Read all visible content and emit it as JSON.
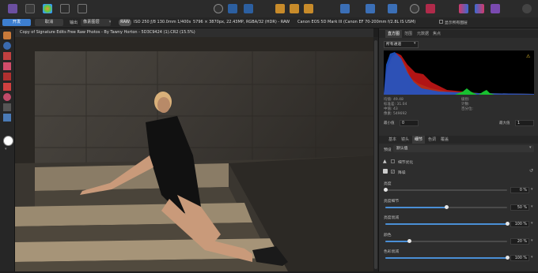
{
  "context_bar": {
    "develop_button": "开发",
    "cancel_button": "取消",
    "output_label": "输出",
    "output_value": "像素图层",
    "raw_badge": "RAW",
    "camera_settings": "ISO 250 ƒ/8 130.0mm 1/400s",
    "image_info": "5796 × 3870px, 22.43MP, RGBA/32 (HDR) - RAW",
    "camera_model": "Canon EOS 5D Mark III (Canon EF 70-200mm f/2.8L IS USM)",
    "show_clipping": "显示所有图层"
  },
  "document": {
    "title": "Copy of Signature Edits Free Raw Photos - By Tawny Horton - 5D3C9424 (1).CR2 (15.5%)"
  },
  "panel": {
    "top_tabs": [
      "直方图",
      "范围",
      "元数据",
      "焦点"
    ],
    "channel_select": "所有通道",
    "histogram_info": {
      "left": [
        {
          "label": "均值",
          "value": "49.48"
        },
        {
          "label": "标准差",
          "value": "31.04"
        },
        {
          "label": "中值",
          "value": "43"
        },
        {
          "label": "像素",
          "value": "549692"
        }
      ],
      "right": [
        {
          "label": "级别:",
          "value": ""
        },
        {
          "label": "计数:",
          "value": ""
        },
        {
          "label": "百分位:",
          "value": ""
        }
      ],
      "min_label": "最小值",
      "min_value": "0",
      "max_label": "最大值",
      "max_value": "1"
    },
    "adjust_tabs": [
      "基本",
      "镜头",
      "细节",
      "色调",
      "覆盖"
    ],
    "preset_label": "预设",
    "preset_value": "默认值",
    "detail_refine_label": "细节优化",
    "noise_label": "降噪",
    "sliders": [
      {
        "label": "亮度",
        "value_text": "0 %",
        "fraction": 0.0
      },
      {
        "label": "亮度细节",
        "value_text": "50 %",
        "fraction": 0.5
      },
      {
        "label": "亮度衰减",
        "value_text": "100 %",
        "fraction": 1.0
      },
      {
        "label": "颜色",
        "value_text": "20 %",
        "fraction": 0.2
      },
      {
        "label": "色彩衰减",
        "value_text": "100 %",
        "fraction": 1.0
      }
    ]
  },
  "colors": {
    "accent": "#4a8fd6",
    "develop_button_bg": "#3d7fd0",
    "histogram_blue": "#1e55c8",
    "histogram_green": "#18c030",
    "histogram_red": "#d01818"
  }
}
